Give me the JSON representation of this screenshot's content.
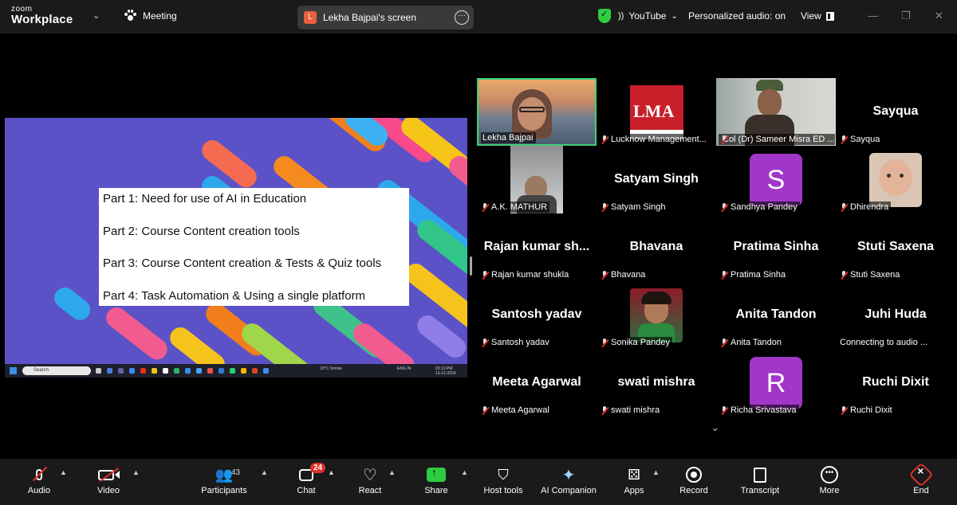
{
  "topbar": {
    "logo_small": "zoom",
    "logo_big": "Workplace",
    "meeting_label": "Meeting",
    "screen_owner_initial": "L",
    "screen_title": "Lekha Bajpai's screen",
    "more_glyph": "···",
    "stream_label": "YouTube",
    "audio_label": "Personalized audio: on",
    "view_label": "View"
  },
  "slide": {
    "lines": [
      "Part 1: Need for use of AI in Education",
      "Part 2: Course Content creation tools",
      "Part 3: Course Content creation & Tests & Quiz tools",
      "Part 4: Task Automation & Using a single platform"
    ],
    "taskbar_search": "Search",
    "weather": "19°C Smoke",
    "lang": "ENG IN",
    "time": "03:13 PM",
    "date": "13-12-2024"
  },
  "participants": [
    {
      "label": "Lekha Bajpai",
      "kind": "video",
      "muted": false
    },
    {
      "label": "Lucknow Management...",
      "kind": "logo",
      "muted": true
    },
    {
      "label": "Col (Dr) Sameer Misra ED ...",
      "kind": "video",
      "muted": true
    },
    {
      "label": "Sayqua",
      "big": "Sayqua",
      "kind": "name",
      "muted": true
    },
    {
      "label": "A.K. MATHUR",
      "kind": "photo",
      "muted": true
    },
    {
      "label": "Satyam Singh",
      "big": "Satyam Singh",
      "kind": "name",
      "muted": true
    },
    {
      "label": "Sandhya Pandey",
      "kind": "letter",
      "letter": "S",
      "muted": true
    },
    {
      "label": "Dhirendra",
      "kind": "photo",
      "muted": true
    },
    {
      "label": "Rajan kumar shukla",
      "big": "Rajan  kumar  sh...",
      "kind": "name",
      "muted": true
    },
    {
      "label": "Bhavana",
      "big": "Bhavana",
      "kind": "name",
      "muted": true
    },
    {
      "label": "Pratima Sinha",
      "big": "Pratima Sinha",
      "kind": "name",
      "muted": true
    },
    {
      "label": "Stuti Saxena",
      "big": "Stuti Saxena",
      "kind": "name",
      "muted": true
    },
    {
      "label": "Santosh yadav",
      "big": "Santosh yadav",
      "kind": "name",
      "muted": true
    },
    {
      "label": "Sonika Pandey",
      "kind": "photo",
      "muted": true
    },
    {
      "label": "Anita Tandon",
      "big": "Anita Tandon",
      "kind": "name",
      "muted": true
    },
    {
      "label": "Connecting to audio ...",
      "big": "Juhi Huda",
      "kind": "name",
      "muted": false
    },
    {
      "label": "Meeta Agarwal",
      "big": "Meeta Agarwal",
      "kind": "name",
      "muted": true
    },
    {
      "label": "swati mishra",
      "big": "swati mishra",
      "kind": "name",
      "muted": true
    },
    {
      "label": "Richa Srivastava",
      "kind": "letter",
      "letter": "R",
      "muted": true
    },
    {
      "label": "Ruchi Dixit",
      "big": "Ruchi Dixit",
      "kind": "name",
      "muted": true
    }
  ],
  "logo_tile_text": "LMA",
  "toolbar": {
    "audio": "Audio",
    "video": "Video",
    "participants": "Participants",
    "participants_count": "43",
    "chat": "Chat",
    "chat_badge": "24",
    "react": "React",
    "share": "Share",
    "host_tools": "Host tools",
    "ai_companion": "AI Companion",
    "apps": "Apps",
    "record": "Record",
    "transcript": "Transcript",
    "more": "More",
    "end": "End"
  },
  "colors": {
    "active_border": "#3fd07a",
    "mute_red": "#e0302a",
    "share_green": "#2ecc40",
    "slide_bg": "#5b52c8",
    "avatar_purple": "#a236c9"
  }
}
